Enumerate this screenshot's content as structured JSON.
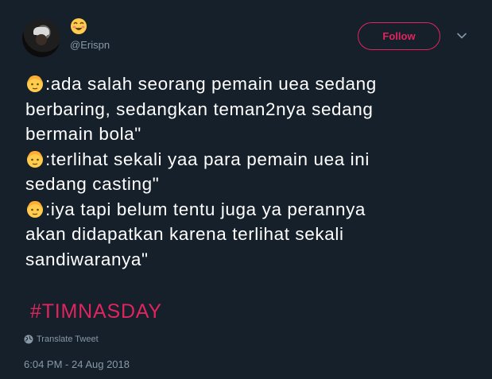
{
  "header": {
    "handle": "@Erispn",
    "follow_label": "Follow"
  },
  "tweet": {
    "lines": [
      ":ada salah seorang pemain uea sedang",
      "berbaring, sedangkan teman2nya sedang",
      "bermain bola\"",
      ":terlihat sekali yaa para pemain uea ini",
      "sedang casting\"",
      ":iya tapi belum tentu juga ya perannya",
      "akan didapatkan karena terlihat sekali",
      "sandiwaranya\""
    ],
    "hashtag": "#TIMNASDAY",
    "translate_label": "Translate Tweet",
    "timestamp": "6:04 PM - 24 Aug 2018"
  },
  "colors": {
    "background": "#15202b",
    "accent": "#e0245e",
    "secondary_text": "#8899a6"
  },
  "icons": {
    "name_emoji": "smiling-face-icon",
    "line_emoji": "person-face-icon",
    "menu": "chevron-down-icon",
    "translate": "globe-icon"
  }
}
